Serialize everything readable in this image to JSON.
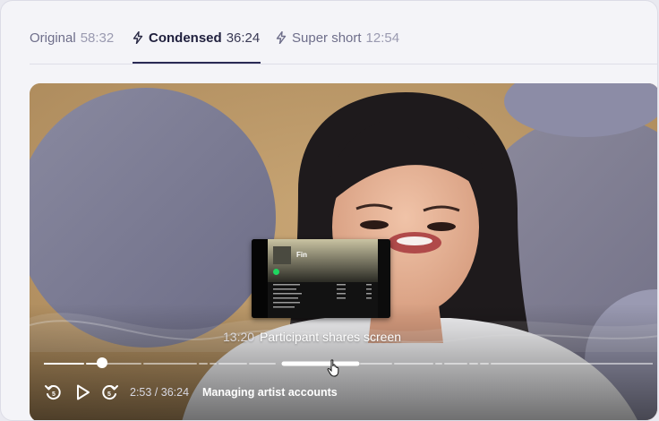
{
  "tabs": [
    {
      "label": "Original",
      "duration": "58:32",
      "active": false,
      "icon": "none"
    },
    {
      "label": "Condensed",
      "duration": "36:24",
      "active": true,
      "icon": "lightning-bolt-icon"
    },
    {
      "label": "Super short",
      "duration": "12:54",
      "active": false,
      "icon": "lightning-bolt-icon"
    }
  ],
  "player": {
    "hover_timestamp": "13:20",
    "hover_chapter": "Participant shares screen",
    "timecode": "2:53 / 36:24",
    "current_chapter": "Managing artist accounts",
    "progress_fraction": 0.0794,
    "controls": {
      "rewind_icon": "rewind-icon",
      "play_icon": "play-icon",
      "forward_icon": "fast-forward-icon"
    }
  },
  "preview": {
    "album_title": "Fin"
  },
  "colors": {
    "active_tab_text": "#1f1f3d",
    "inactive_tab_text": "#6e6e8a",
    "duration_text": "#9a9ab0",
    "card_background": "#f4f4f8"
  }
}
